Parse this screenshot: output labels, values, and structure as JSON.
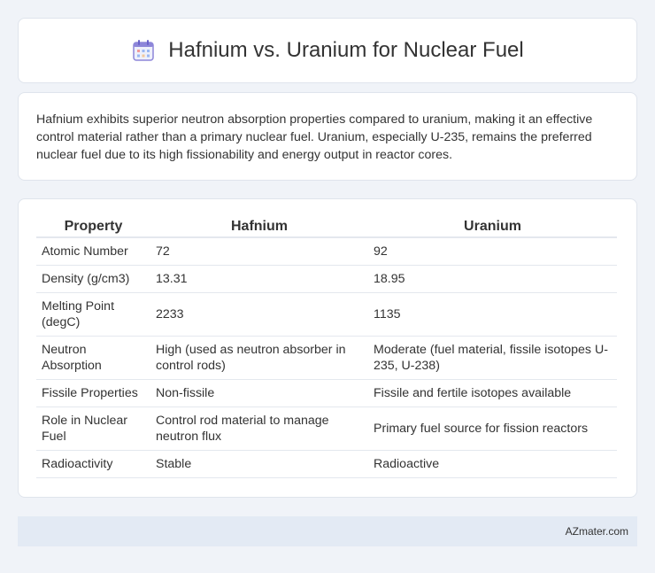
{
  "header": {
    "title": "Hafnium vs. Uranium for Nuclear Fuel",
    "icon": "calendar-grid-icon",
    "icon_color": "#7b6fd6"
  },
  "intro": {
    "text": "Hafnium exhibits superior neutron absorption properties compared to uranium, making it an effective control material rather than a primary nuclear fuel. Uranium, especially U-235, remains the preferred nuclear fuel due to its high fissionability and energy output in reactor cores."
  },
  "table": {
    "headers": [
      "Property",
      "Hafnium",
      "Uranium"
    ],
    "rows": [
      [
        "Atomic Number",
        "72",
        "92"
      ],
      [
        "Density (g/cm3)",
        "13.31",
        "18.95"
      ],
      [
        "Melting Point (degC)",
        "2233",
        "1135"
      ],
      [
        "Neutron Absorption",
        "High (used as neutron absorber in control rods)",
        "Moderate (fuel material, fissile isotopes U-235, U-238)"
      ],
      [
        "Fissile Properties",
        "Non-fissile",
        "Fissile and fertile isotopes available"
      ],
      [
        "Role in Nuclear Fuel",
        "Control rod material to manage neutron flux",
        "Primary fuel source for fission reactors"
      ],
      [
        "Radioactivity",
        "Stable",
        "Radioactive"
      ]
    ]
  },
  "footer": {
    "brand": "AZmater.com"
  }
}
